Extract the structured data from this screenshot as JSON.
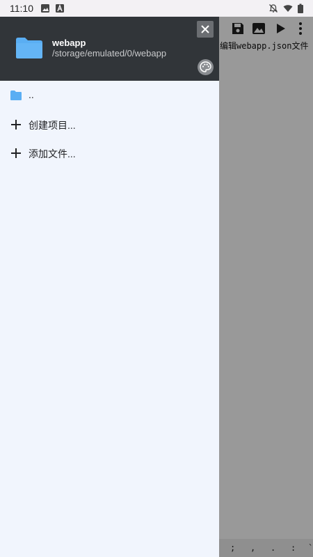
{
  "status_bar": {
    "time": "11:10",
    "icons": [
      "image-icon",
      "font-icon",
      "notifications-off-icon",
      "wifi-icon",
      "battery-icon"
    ]
  },
  "background_app": {
    "toolbar_icons": [
      "save-icon",
      "image-icon",
      "play-icon",
      "more-vert-icon"
    ],
    "hint": "编辑webapp.json文件",
    "bottom_keys": [
      ";",
      ",",
      ".",
      ":",
      "`"
    ]
  },
  "drawer": {
    "header": {
      "title": "webapp",
      "path": "/storage/emulated/0/webapp",
      "icons": [
        "folder-icon",
        "close-icon",
        "palette-icon"
      ]
    },
    "items": [
      {
        "label": "..",
        "icon": "folder-icon"
      },
      {
        "label": "创建项目...",
        "icon": "add-icon"
      },
      {
        "label": "添加文件...",
        "icon": "add-icon"
      }
    ]
  },
  "colors": {
    "drawer_header_bg": "#313539",
    "drawer_bg": "#f1f5fd",
    "folder_blue": "#5aaef3",
    "scrim": "#9a9a9a"
  }
}
